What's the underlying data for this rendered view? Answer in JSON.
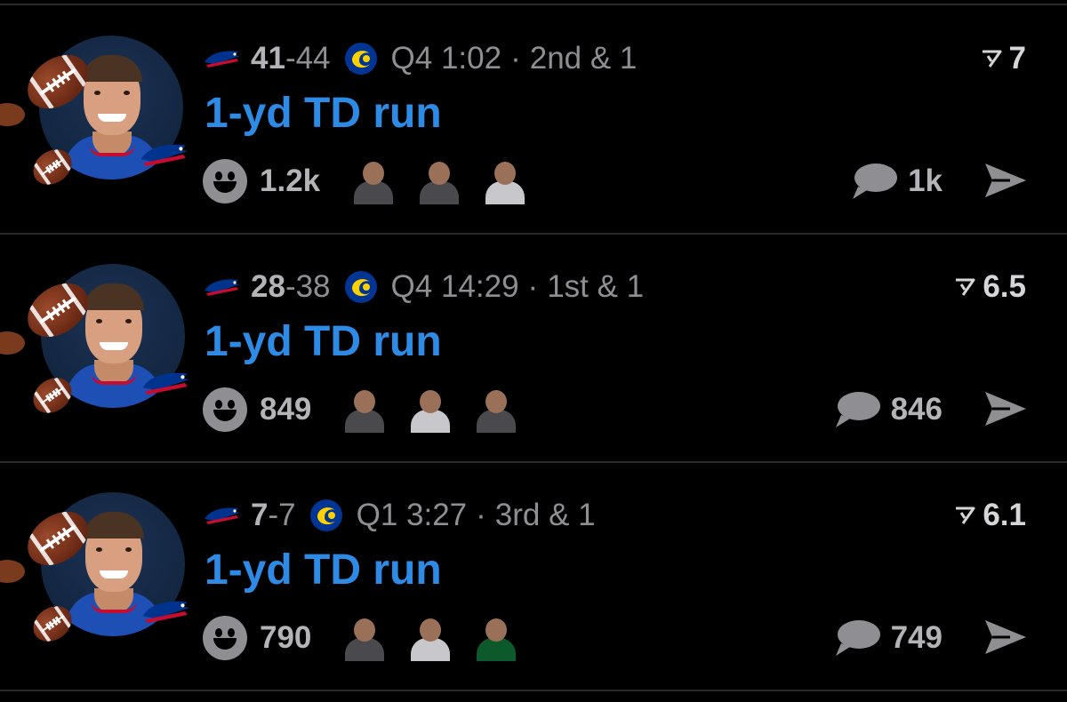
{
  "colors": {
    "background": "#000000",
    "separator": "#2a2a2c",
    "title_blue": "#2d8be5",
    "meta_gray": "#8e8e93",
    "score_gray": "#b4b4b8",
    "rating_text": "#d6d6d9",
    "avatar_bg": "#142844",
    "bills_blue": "#00338d",
    "bills_red": "#c60c30",
    "rams_gold": "#ffd100"
  },
  "icons": {
    "team_left": "bills-logo-icon",
    "team_right": "rams-logo-icon",
    "rating": "rating-bracket-icon",
    "reaction": "smiley-face-icon",
    "comment": "speech-bubble-icon",
    "share": "paper-plane-share-icon",
    "decoration": "football-emoji-icon"
  },
  "plays": [
    {
      "score_home": "41",
      "score_away": "44",
      "quarter_clock": "Q4 1:02",
      "down": "2nd & 1",
      "title": "1-yd TD run",
      "rating": "7",
      "reaction_count": "1.2k",
      "comment_count": "1k",
      "stickers": [
        "screaming-fan-sticker",
        "bald-man-sticker",
        "basketball-player-sticker"
      ]
    },
    {
      "score_home": "28",
      "score_away": "38",
      "quarter_clock": "Q4 14:29",
      "down": "1st & 1",
      "title": "1-yd TD run",
      "rating": "6.5",
      "reaction_count": "849",
      "comment_count": "846",
      "stickers": [
        "bald-man-sticker",
        "basketball-player-sticker",
        "man-in-chair-sticker"
      ]
    },
    {
      "score_home": "7",
      "score_away": "7",
      "quarter_clock": "Q1 3:27",
      "down": "3rd & 1",
      "title": "1-yd TD run",
      "rating": "6.1",
      "reaction_count": "790",
      "comment_count": "749",
      "stickers": [
        "bald-man-sticker",
        "basketball-player-sticker",
        "green-jersey-player-sticker"
      ]
    }
  ]
}
